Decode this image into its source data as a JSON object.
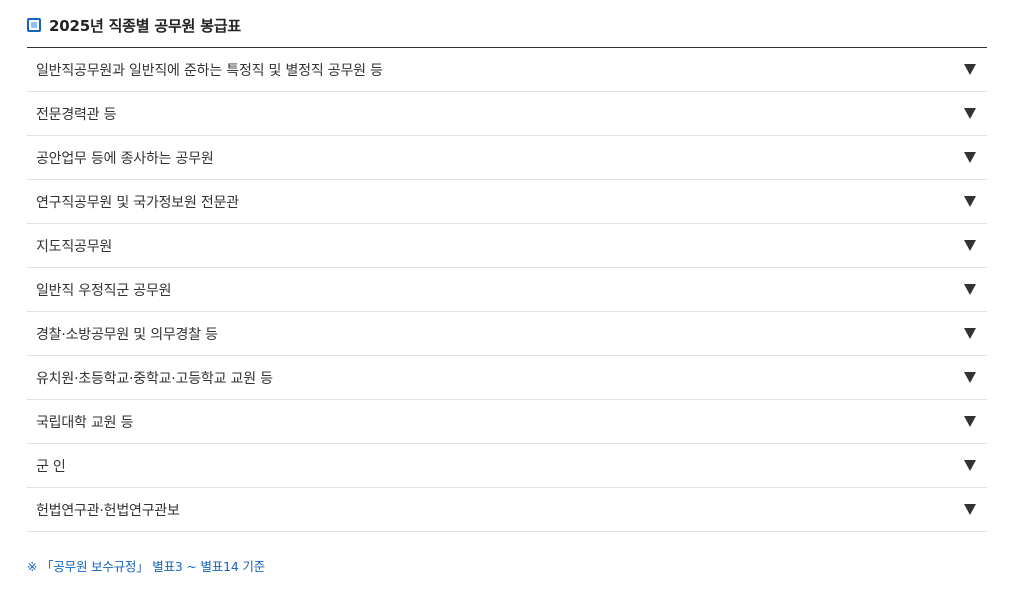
{
  "header": {
    "icon": "checkbox-square-icon",
    "title": "2025년 직종별 공무원 봉급표"
  },
  "accordion": {
    "items": [
      {
        "label": "일반직공무원과 일반직에 준하는 특정직 및 별정직 공무원 등"
      },
      {
        "label": "전문경력관 등"
      },
      {
        "label": "공안업무 등에 종사하는 공무원"
      },
      {
        "label": "연구직공무원 및 국가정보원 전문관"
      },
      {
        "label": "지도직공무원"
      },
      {
        "label": "일반직 우정직군 공무원"
      },
      {
        "label": "경찰·소방공무원 및 의무경찰 등"
      },
      {
        "label": "유치원·초등학교·중학교·고등학교 교원 등"
      },
      {
        "label": "국립대학 교원 등"
      },
      {
        "label": "군 인"
      },
      {
        "label": "헌법연구관·헌법연구관보"
      }
    ],
    "expand_icon": "triangle-down-icon"
  },
  "footnote": "※ 「공무원 보수규정」 별표3 ~ 별표14 기준",
  "colors": {
    "accent": "#1565c0",
    "text": "#333333",
    "divider": "#e1e1e1"
  }
}
